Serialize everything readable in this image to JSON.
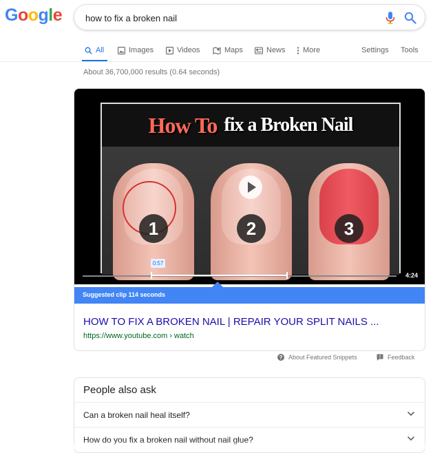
{
  "logo": {
    "letters": [
      "G",
      "o",
      "o",
      "g",
      "l",
      "e"
    ],
    "colors": [
      "#4285f4",
      "#ea4335",
      "#fbbc05",
      "#4285f4",
      "#34a853",
      "#ea4335"
    ]
  },
  "search": {
    "query": "how to fix a broken nail"
  },
  "tabs": {
    "all": "All",
    "images": "Images",
    "videos": "Videos",
    "maps": "Maps",
    "news": "News",
    "more": "More",
    "settings": "Settings",
    "tools": "Tools"
  },
  "result_stats": "About 36,700,000 results (0.64 seconds)",
  "featured": {
    "thumbnail_title_part1": "How To",
    "thumbnail_title_part2": "fix a Broken Nail",
    "nail_numbers": [
      "1",
      "2",
      "3"
    ],
    "timestamp": "0:57",
    "duration": "4:24",
    "clip_label": "Suggested clip 114 seconds",
    "title": "HOW TO FIX A BROKEN NAIL | REPAIR YOUR SPLIT NAILS ...",
    "url": "https://www.youtube.com › watch"
  },
  "footer": {
    "about": "About Featured Snippets",
    "feedback": "Feedback"
  },
  "people_also_ask": {
    "title": "People also ask",
    "questions": [
      "Can a broken nail heal itself?",
      "How do you fix a broken nail without nail glue?"
    ]
  },
  "colors": {
    "accent": "#1a73e8",
    "link": "#1a0dab",
    "url": "#006621",
    "clip_bar": "#4285f4"
  }
}
